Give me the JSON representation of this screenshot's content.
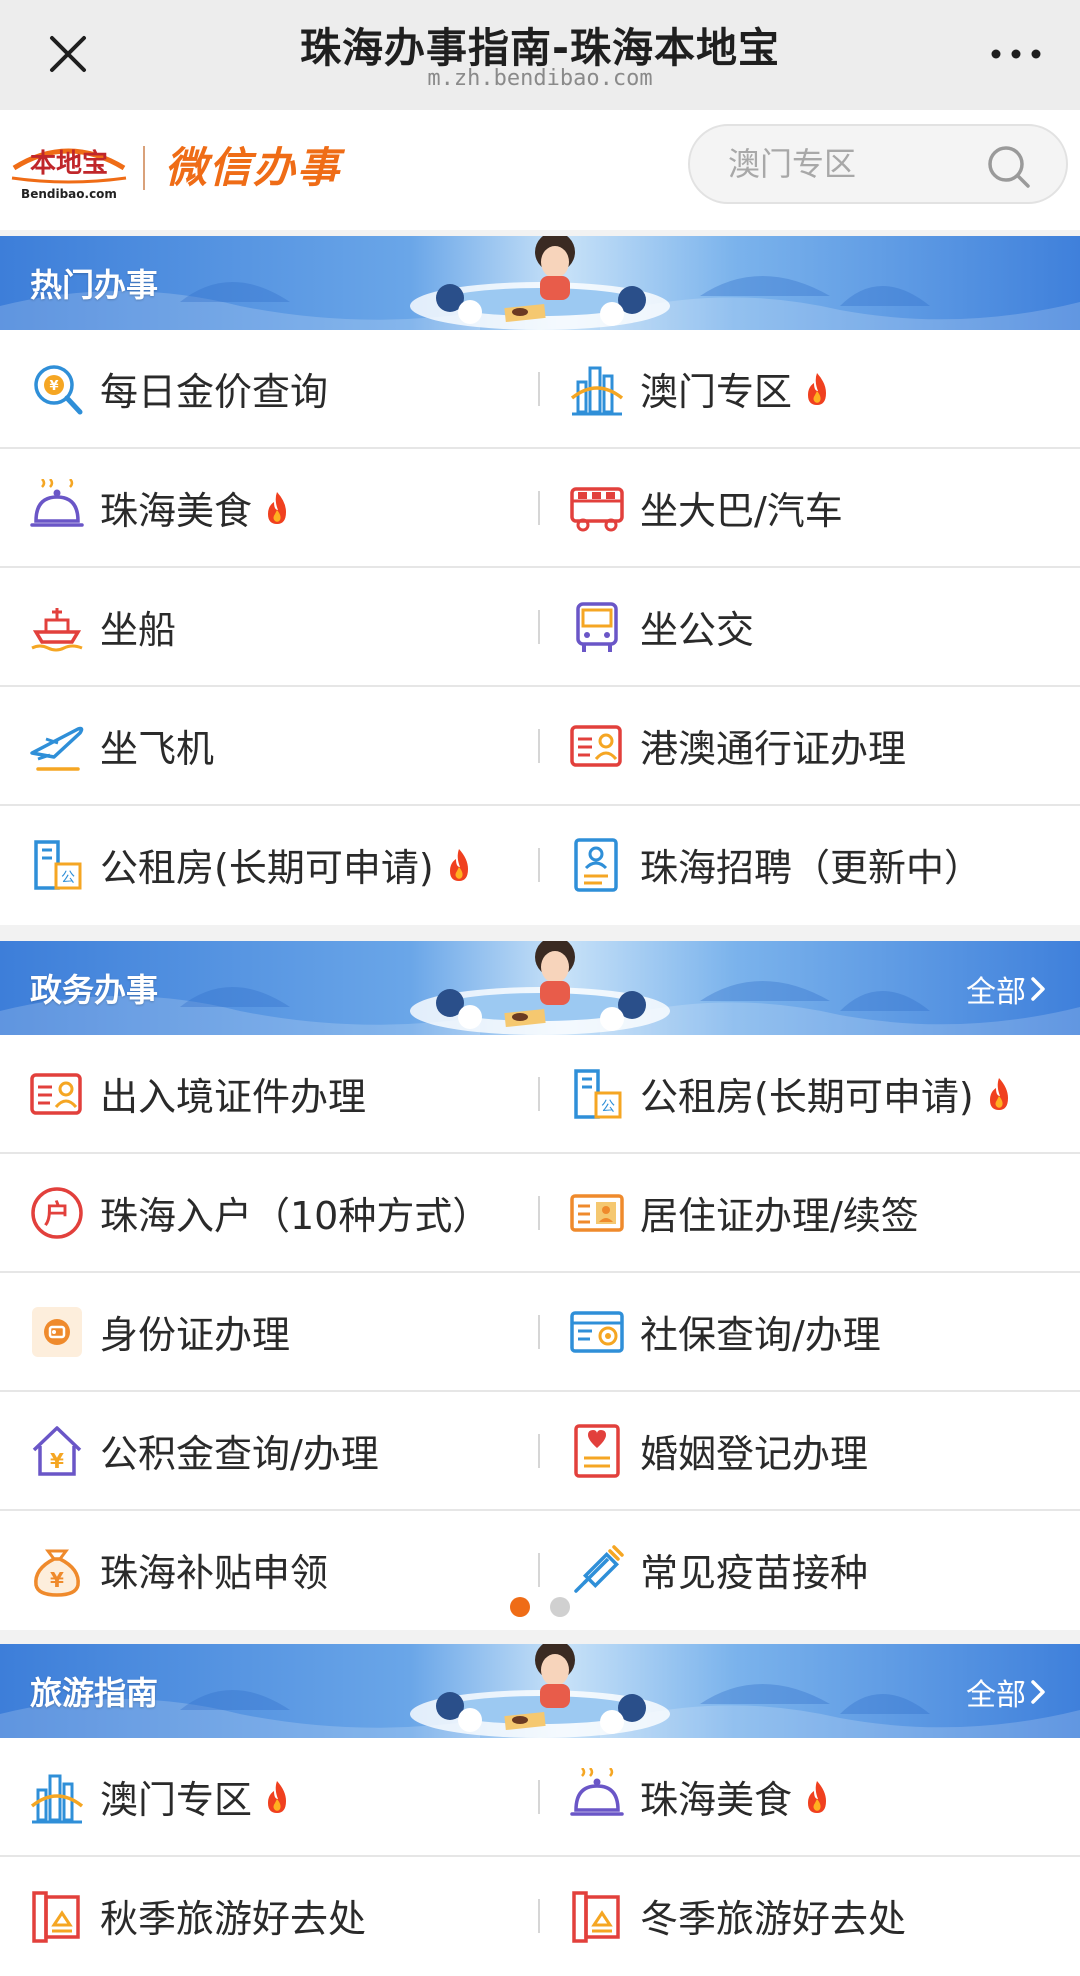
{
  "browser": {
    "title": "珠海办事指南-珠海本地宝",
    "url": "m.zh.bendibao.com"
  },
  "header": {
    "logo_text": "本地宝",
    "logo_sub": "Bendibao.com",
    "brand": "微信办事",
    "search_placeholder": "澳门专区"
  },
  "sections": [
    {
      "title": "热门办事",
      "more": "",
      "items": [
        {
          "label": "每日金价查询",
          "icon": "gold-price-icon",
          "hot": false
        },
        {
          "label": "澳门专区",
          "icon": "macau-building-icon",
          "hot": true
        },
        {
          "label": "珠海美食",
          "icon": "food-cloche-icon",
          "hot": true
        },
        {
          "label": "坐大巴/汽车",
          "icon": "bus-icon",
          "hot": false
        },
        {
          "label": "坐船",
          "icon": "ship-icon",
          "hot": false
        },
        {
          "label": "坐公交",
          "icon": "city-bus-icon",
          "hot": false
        },
        {
          "label": "坐飞机",
          "icon": "airplane-icon",
          "hot": false
        },
        {
          "label": "港澳通行证办理",
          "icon": "pass-card-icon",
          "hot": false
        },
        {
          "label": "公租房(长期可申请)",
          "icon": "public-housing-icon",
          "hot": true
        },
        {
          "label": "珠海招聘（更新中）",
          "icon": "recruit-doc-icon",
          "hot": false
        }
      ]
    },
    {
      "title": "政务办事",
      "more": "全部",
      "items": [
        {
          "label": "出入境证件办理",
          "icon": "id-card-icon",
          "hot": false
        },
        {
          "label": "公租房(长期可申请)",
          "icon": "public-housing-icon",
          "hot": true
        },
        {
          "label": "珠海入户（10种方式）",
          "icon": "household-icon",
          "hot": false
        },
        {
          "label": "居住证办理/续签",
          "icon": "residence-card-icon",
          "hot": false
        },
        {
          "label": "身份证办理",
          "icon": "identity-card-icon",
          "hot": false
        },
        {
          "label": "社保查询/办理",
          "icon": "social-security-icon",
          "hot": false
        },
        {
          "label": "公积金查询/办理",
          "icon": "housing-fund-icon",
          "hot": false
        },
        {
          "label": "婚姻登记办理",
          "icon": "marriage-icon",
          "hot": false
        },
        {
          "label": "珠海补贴申领",
          "icon": "money-bag-icon",
          "hot": false
        },
        {
          "label": "常见疫苗接种",
          "icon": "vaccine-icon",
          "hot": false
        }
      ]
    },
    {
      "title": "旅游指南",
      "more": "全部",
      "items": [
        {
          "label": "澳门专区",
          "icon": "macau-building-icon",
          "hot": true
        },
        {
          "label": "珠海美食",
          "icon": "food-cloche-icon",
          "hot": true
        },
        {
          "label": "秋季旅游好去处",
          "icon": "travel-scroll-icon",
          "hot": false
        },
        {
          "label": "冬季旅游好去处",
          "icon": "travel-scroll-icon",
          "hot": false
        }
      ]
    }
  ],
  "pager": {
    "pages": 2,
    "current": 1
  },
  "colors": {
    "brand_orange": "#ef6c16",
    "banner_blue": "#3d7ed9",
    "fire_red": "#f0401f",
    "dot_active": "#ef6c16",
    "dot_inactive": "#d0d0d0"
  }
}
